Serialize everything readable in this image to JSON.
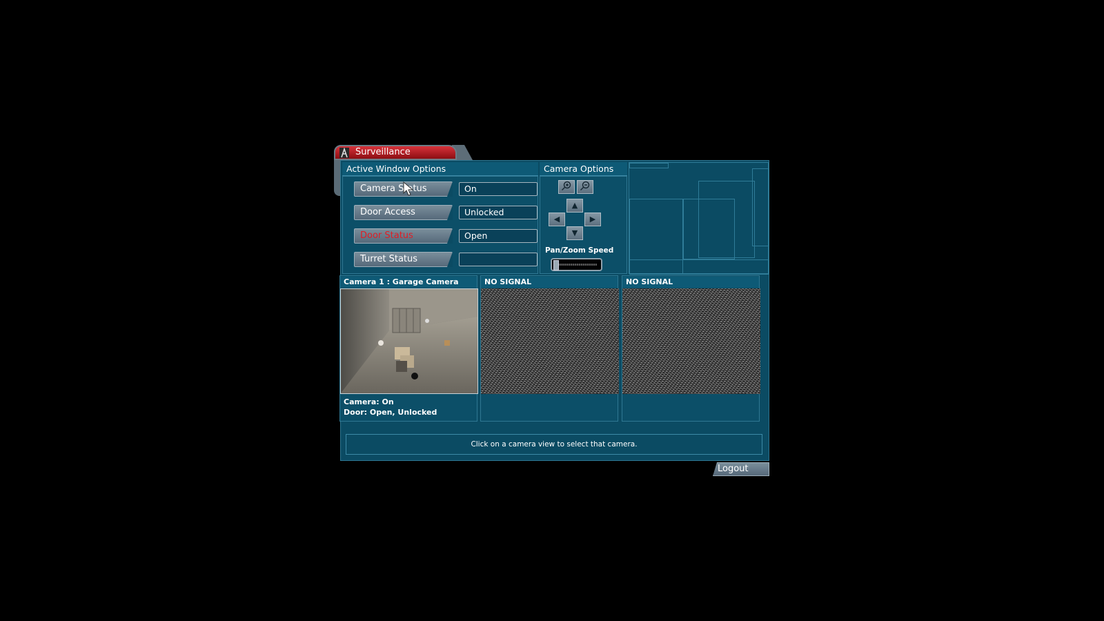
{
  "window": {
    "title": "Surveillance"
  },
  "active_window_options": {
    "header": "Active Window Options",
    "options": [
      {
        "label": "Camera Status",
        "value": "On",
        "highlight": false
      },
      {
        "label": "Door Access",
        "value": "Unlocked",
        "highlight": false
      },
      {
        "label": "Door Status",
        "value": "Open",
        "highlight": true
      },
      {
        "label": "Turret Status",
        "value": "",
        "highlight": false
      }
    ]
  },
  "camera_options": {
    "header": "Camera Options",
    "zoom_in_icon": "zoom-in-icon",
    "zoom_out_icon": "zoom-out-icon",
    "speed_label": "Pan/Zoom Speed"
  },
  "cameras": [
    {
      "title": "Camera 1 : Garage Camera",
      "status_line": "Camera: On",
      "door_line": "Door: Open, Unlocked",
      "signal": true
    },
    {
      "title": "NO SIGNAL",
      "status_line": "",
      "door_line": "",
      "signal": false
    },
    {
      "title": "NO SIGNAL",
      "status_line": "",
      "door_line": "",
      "signal": false
    }
  ],
  "status_message": "Click on a camera view to select that camera.",
  "logout_label": "Logout",
  "colors": {
    "frame_bg": "#0b4b63",
    "tab_red": "#d8323a",
    "highlight_red": "#e11d24"
  }
}
